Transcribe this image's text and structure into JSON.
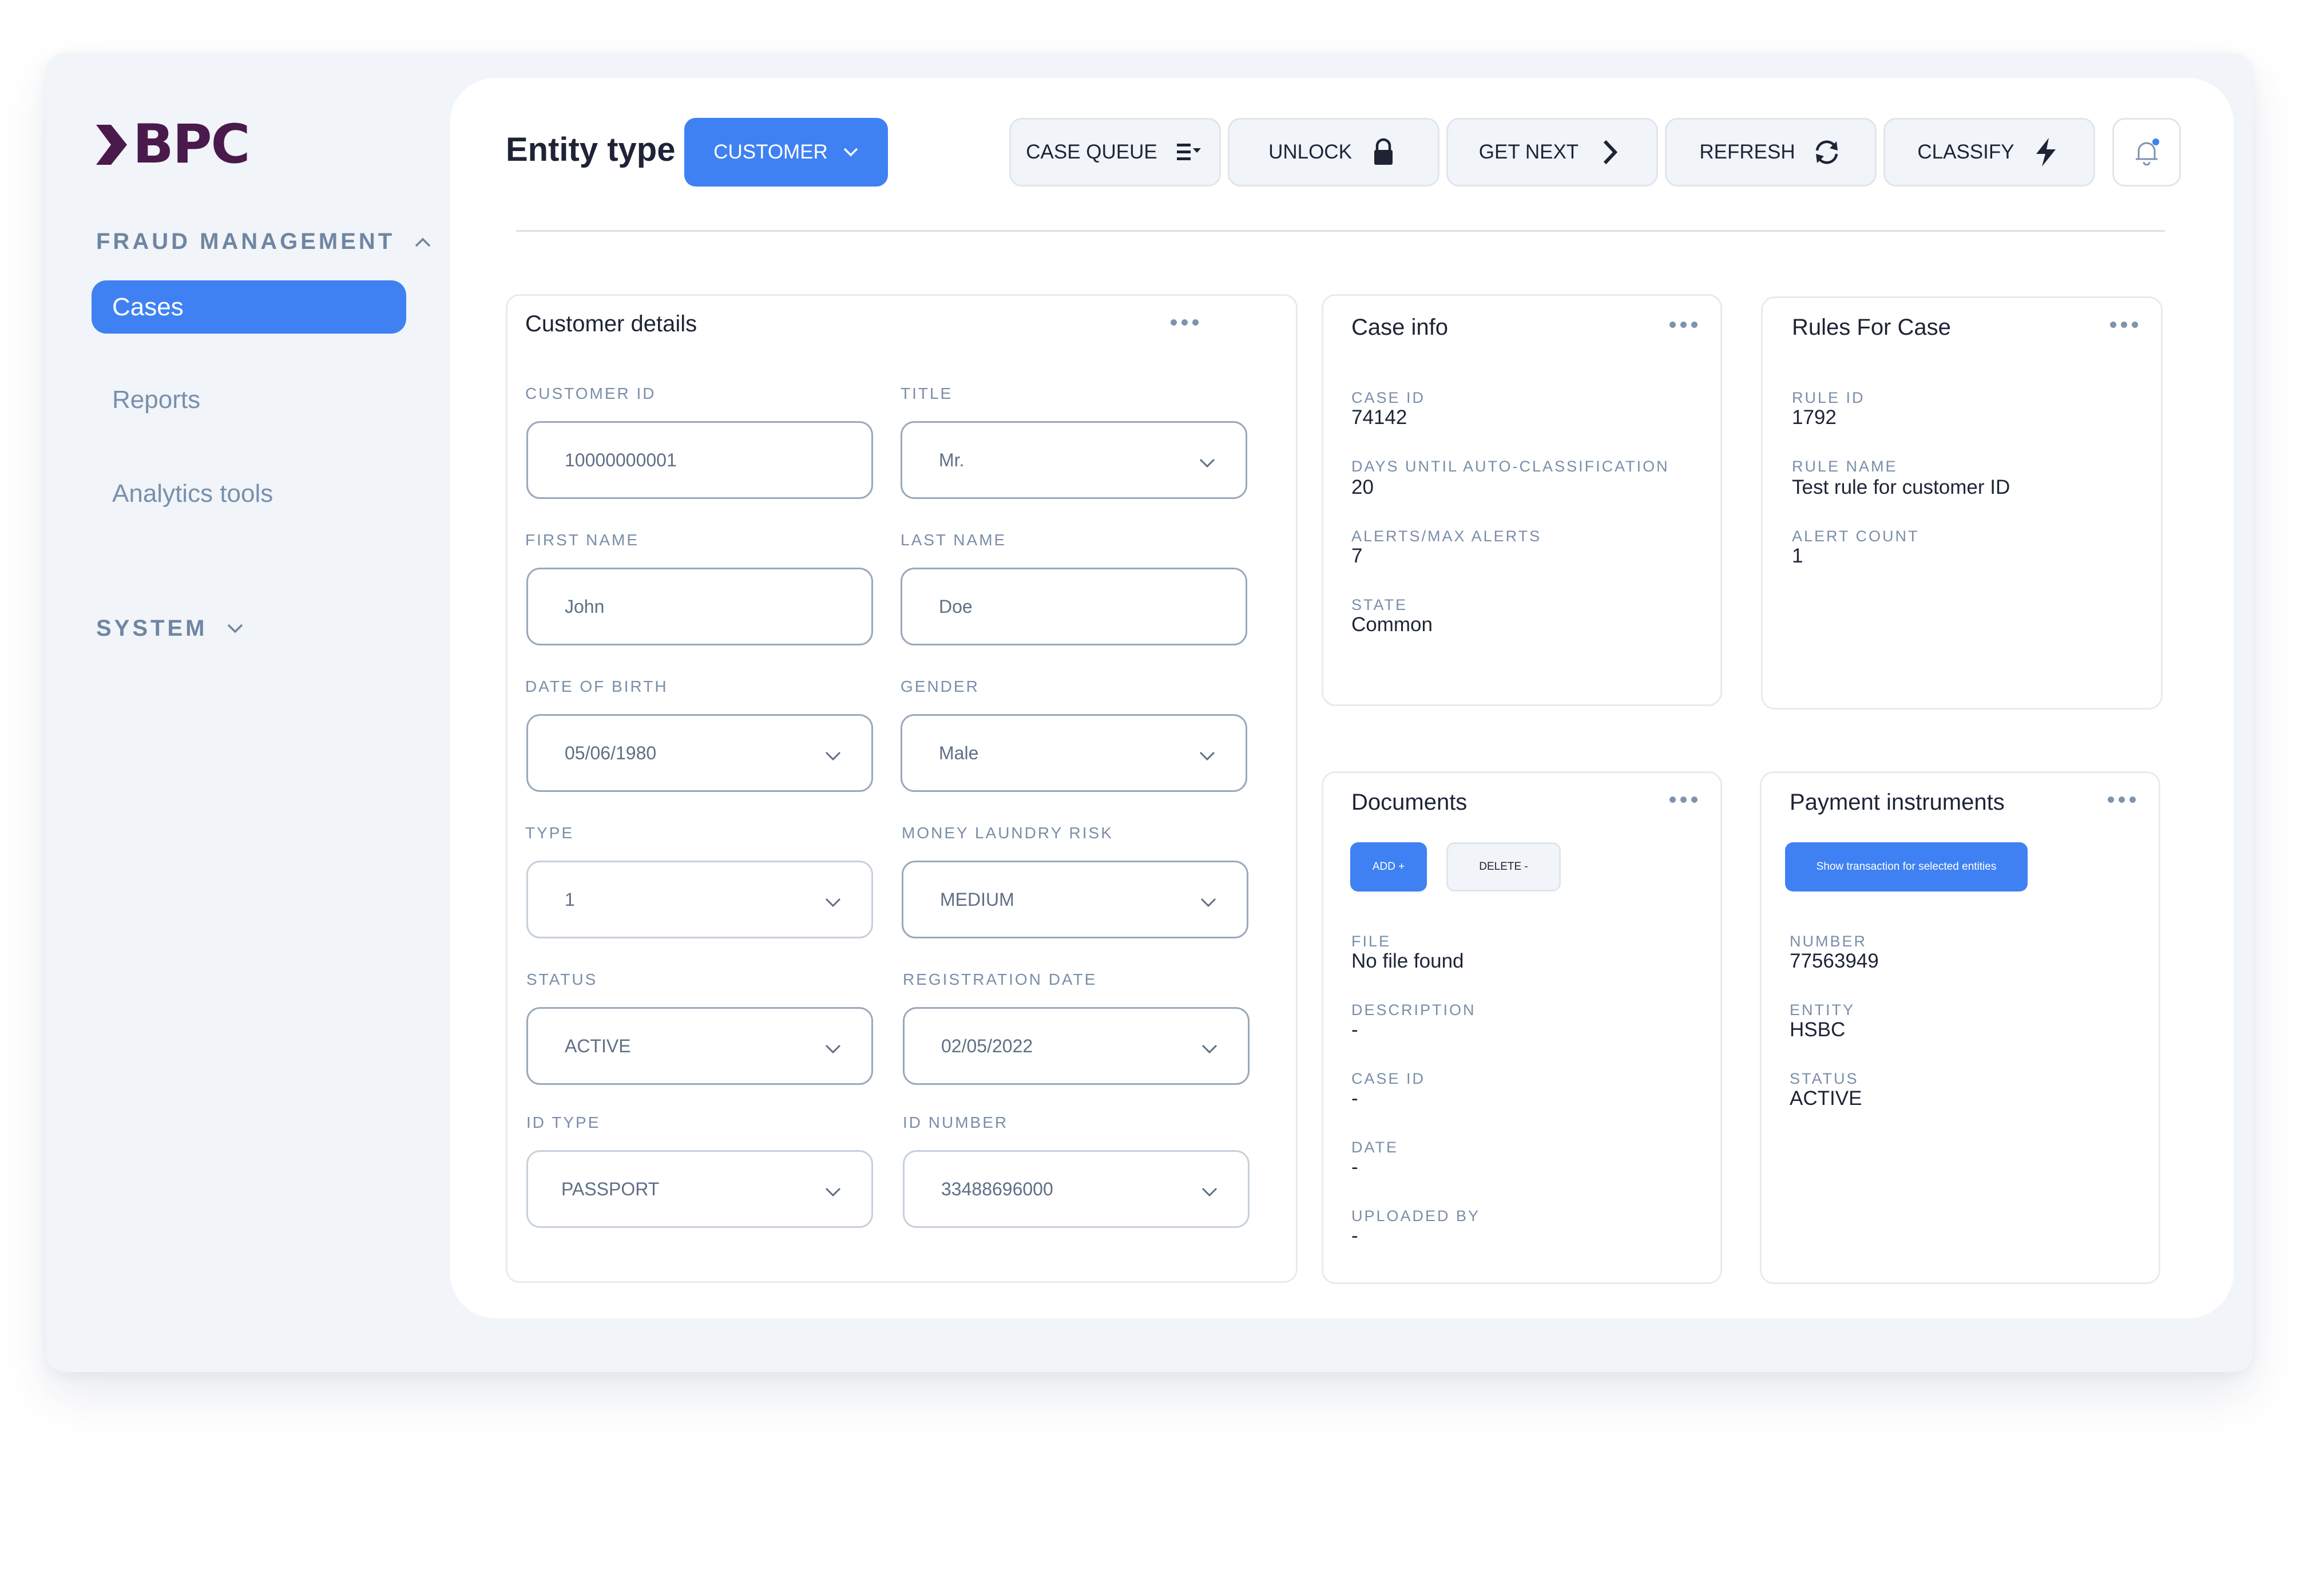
{
  "brand": {
    "logo_text": "BPC"
  },
  "sidebar": {
    "fraud_section": "FRAUD MANAGEMENT",
    "items": [
      {
        "label": "Cases",
        "active": true
      },
      {
        "label": "Reports"
      },
      {
        "label": "Analytics tools"
      }
    ],
    "system_section": "SYSTEM"
  },
  "header": {
    "entity_type_label": "Entity type",
    "entity_type_value": "CUSTOMER",
    "toolbar": {
      "case_queue": "CASE QUEUE",
      "unlock": "UNLOCK",
      "get_next": "GET NEXT",
      "refresh": "REFRESH",
      "classify": "CLASSIFY"
    }
  },
  "customer_details": {
    "title": "Customer details",
    "fields": {
      "customer_id": {
        "label": "CUSTOMER ID",
        "value": "10000000001"
      },
      "title": {
        "label": "TITLE",
        "value": "Mr."
      },
      "first_name": {
        "label": "FIRST NAME",
        "value": "John"
      },
      "last_name": {
        "label": "LAST NAME",
        "value": "Doe"
      },
      "date_of_birth": {
        "label": "DATE OF BIRTH",
        "value": "05/06/1980"
      },
      "gender": {
        "label": "GENDER",
        "value": "Male"
      },
      "type": {
        "label": "TYPE",
        "value": "1"
      },
      "money_laundry_risk": {
        "label": "MONEY LAUNDRY RISK",
        "value": "MEDIUM"
      },
      "status": {
        "label": "STATUS",
        "value": "ACTIVE"
      },
      "registration_date": {
        "label": "REGISTRATION DATE",
        "value": "02/05/2022"
      },
      "id_type": {
        "label": "ID TYPE",
        "value": "PASSPORT"
      },
      "id_number": {
        "label": "ID NUMBER",
        "value": "33488696000"
      }
    }
  },
  "case_info": {
    "title": "Case info",
    "case_id": {
      "label": "CASE ID",
      "value": "74142"
    },
    "days_until": {
      "label": "DAYS UNTIL AUTO-CLASSIFICATION",
      "value": "20"
    },
    "alerts": {
      "label": "ALERTS/MAX ALERTS",
      "value": "7"
    },
    "state": {
      "label": "STATE",
      "value": "Common"
    }
  },
  "rules_for_case": {
    "title": "Rules For Case",
    "rule_id": {
      "label": "RULE ID",
      "value": "1792"
    },
    "rule_name": {
      "label": "RULE NAME",
      "value": "Test rule for customer ID"
    },
    "alert_count": {
      "label": "ALERT COUNT",
      "value": "1"
    }
  },
  "documents": {
    "title": "Documents",
    "add_label": "ADD +",
    "delete_label": "DELETE -",
    "file": {
      "label": "FILE",
      "value": "No file found"
    },
    "description": {
      "label": "DESCRIPTION",
      "value": "-"
    },
    "case_id": {
      "label": "CASE ID",
      "value": "-"
    },
    "date": {
      "label": "DATE",
      "value": "-"
    },
    "uploaded_by": {
      "label": "UPLOADED BY",
      "value": "-"
    }
  },
  "payment_instruments": {
    "title": "Payment instruments",
    "show_button": "Show transaction for selected entities",
    "number": {
      "label": "NUMBER",
      "value": "77563949"
    },
    "entity": {
      "label": "ENTITY",
      "value": "HSBC"
    },
    "status": {
      "label": "STATUS",
      "value": "ACTIVE"
    }
  },
  "colors": {
    "accent": "#3f81f2",
    "brand": "#4a1a4c",
    "muted": "#7a8ea8",
    "background": "#f1f4f8"
  },
  "icons": [
    "chevron-up-icon",
    "chevron-down-icon",
    "list-filter-icon",
    "lock-icon",
    "chevron-right-icon",
    "refresh-icon",
    "lightning-icon",
    "bell-icon",
    "more-dots-icon"
  ]
}
